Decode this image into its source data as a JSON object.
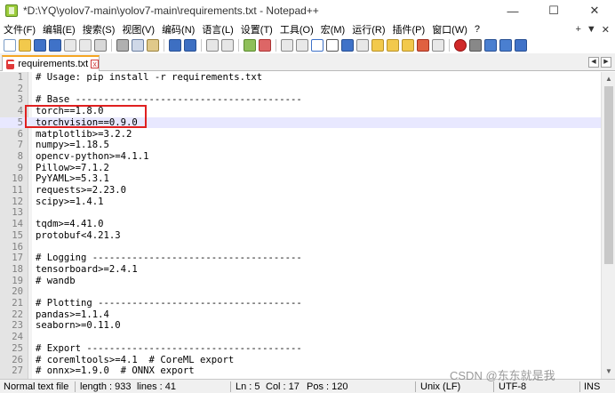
{
  "window": {
    "title": "*D:\\YQ\\yolov7-main\\yolov7-main\\requirements.txt - Notepad++",
    "minimize": "—",
    "maximize": "☐",
    "close": "✕"
  },
  "menu": {
    "items": [
      "文件(F)",
      "编辑(E)",
      "搜索(S)",
      "视图(V)",
      "编码(N)",
      "语言(L)",
      "设置(T)",
      "工具(O)",
      "宏(M)",
      "运行(R)",
      "插件(P)",
      "窗口(W)",
      "?"
    ],
    "right": [
      "+",
      "▼",
      "✕"
    ]
  },
  "tab": {
    "label": "requirements.txt",
    "close": "x"
  },
  "editor": {
    "lines": [
      "# Usage: pip install -r requirements.txt",
      "",
      "# Base ----------------------------------------",
      "torch==1.8.0",
      "torchvision==0.9.0",
      "matplotlib>=3.2.2",
      "numpy>=1.18.5",
      "opencv-python>=4.1.1",
      "Pillow>=7.1.2",
      "PyYAML>=5.3.1",
      "requests>=2.23.0",
      "scipy>=1.4.1",
      "",
      "tqdm>=4.41.0",
      "protobuf<4.21.3",
      "",
      "# Logging -------------------------------------",
      "tensorboard>=2.4.1",
      "# wandb",
      "",
      "# Plotting ------------------------------------",
      "pandas>=1.1.4",
      "seaborn>=0.11.0",
      "",
      "# Export --------------------------------------",
      "# coremltools>=4.1  # CoreML export",
      "# onnx>=1.9.0  # ONNX export"
    ]
  },
  "status": {
    "file_type": "Normal text file",
    "length": "length : 933",
    "lines": "lines : 41",
    "ln": "Ln : 5",
    "col": "Col : 17",
    "pos": "Pos : 120",
    "eol": "Unix (LF)",
    "encoding": "UTF-8",
    "ins": "INS"
  },
  "watermark": "CSDN @东东就是我",
  "colors": {
    "highlight_box": "#e02020",
    "current_line": "#e8e8ff",
    "tab_accent": "#f5a623"
  }
}
